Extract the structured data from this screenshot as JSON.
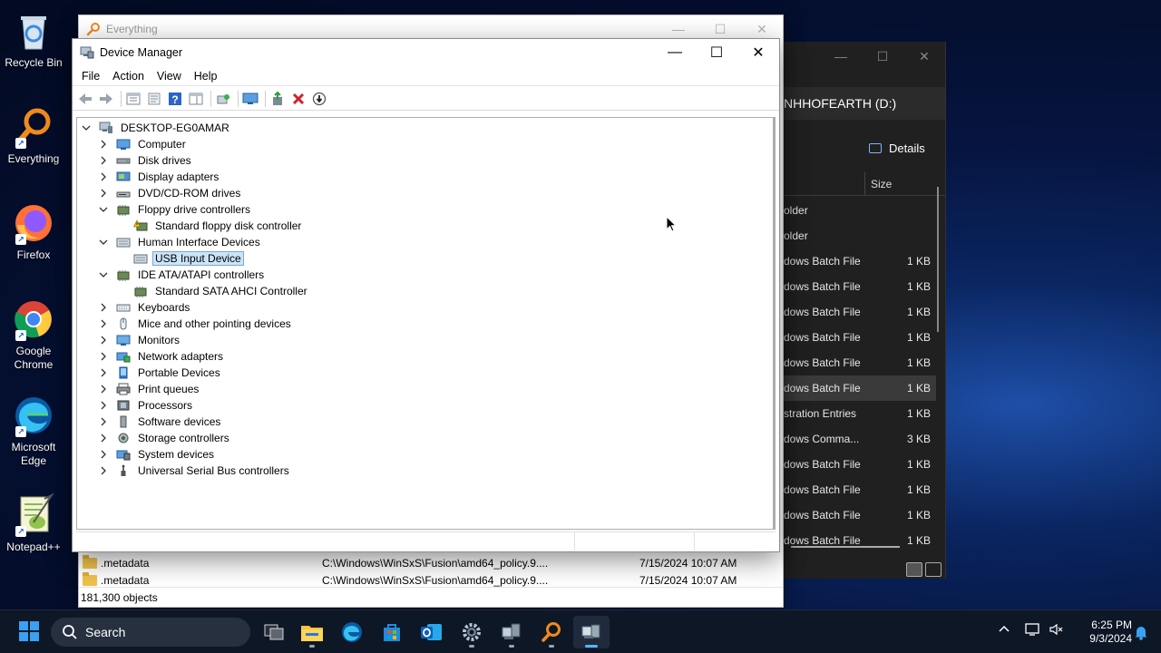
{
  "desktop": {
    "icons": [
      {
        "label": "Recycle Bin",
        "icon": "recycle-bin-icon"
      },
      {
        "label": "Everything",
        "icon": "everything-icon"
      },
      {
        "label": "Firefox",
        "icon": "firefox-icon"
      },
      {
        "label": "Google Chrome",
        "icon": "chrome-icon"
      },
      {
        "label": "Microsoft Edge",
        "icon": "edge-icon"
      },
      {
        "label": "Notepad++",
        "icon": "notepadpp-icon"
      }
    ]
  },
  "everything": {
    "title": "Everything",
    "rows": [
      {
        "name": ".metadata",
        "path": "C:\\Windows\\WinSxS\\Fusion\\amd64_policy.9....",
        "date": "7/15/2024 10:07 AM"
      },
      {
        "name": ".metadata",
        "path": "C:\\Windows\\WinSxS\\Fusion\\amd64_policy.9....",
        "date": "7/15/2024 10:07 AM"
      }
    ],
    "status": "181,300 objects"
  },
  "explorer": {
    "address": "NHHOFEARTH (D:)",
    "details_label": "Details",
    "size_header": "Size",
    "rows": [
      {
        "type": "older",
        "size": ""
      },
      {
        "type": "older",
        "size": ""
      },
      {
        "type": "dows Batch File",
        "size": "1 KB"
      },
      {
        "type": "dows Batch File",
        "size": "1 KB"
      },
      {
        "type": "dows Batch File",
        "size": "1 KB"
      },
      {
        "type": "dows Batch File",
        "size": "1 KB"
      },
      {
        "type": "dows Batch File",
        "size": "1 KB"
      },
      {
        "type": "dows Batch File",
        "size": "1 KB",
        "selected": true
      },
      {
        "type": "stration Entries",
        "size": "1 KB"
      },
      {
        "type": "dows Comma...",
        "size": "3 KB"
      },
      {
        "type": "dows Batch File",
        "size": "1 KB"
      },
      {
        "type": "dows Batch File",
        "size": "1 KB"
      },
      {
        "type": "dows Batch File",
        "size": "1 KB"
      },
      {
        "type": "dows Batch File",
        "size": "1 KB"
      }
    ]
  },
  "device_manager": {
    "title": "Device Manager",
    "menu": [
      "File",
      "Action",
      "View",
      "Help"
    ],
    "root": "DESKTOP-EG0AMAR",
    "tree": [
      {
        "label": "Computer",
        "level": 1,
        "expanded": false,
        "icon": "computer-icon"
      },
      {
        "label": "Disk drives",
        "level": 1,
        "expanded": false,
        "icon": "disk-drive-icon"
      },
      {
        "label": "Display adapters",
        "level": 1,
        "expanded": false,
        "icon": "display-adapter-icon"
      },
      {
        "label": "DVD/CD-ROM drives",
        "level": 1,
        "expanded": false,
        "icon": "dvd-drive-icon"
      },
      {
        "label": "Floppy drive controllers",
        "level": 1,
        "expanded": true,
        "icon": "controller-icon"
      },
      {
        "label": "Standard floppy disk controller",
        "level": 2,
        "icon": "warning-device-icon"
      },
      {
        "label": "Human Interface Devices",
        "level": 1,
        "expanded": true,
        "icon": "hid-icon"
      },
      {
        "label": "USB Input Device",
        "level": 2,
        "icon": "hid-device-icon",
        "selected": true
      },
      {
        "label": "IDE ATA/ATAPI controllers",
        "level": 1,
        "expanded": true,
        "icon": "controller-icon"
      },
      {
        "label": "Standard SATA AHCI Controller",
        "level": 2,
        "icon": "controller-icon"
      },
      {
        "label": "Keyboards",
        "level": 1,
        "expanded": false,
        "icon": "keyboard-icon"
      },
      {
        "label": "Mice and other pointing devices",
        "level": 1,
        "expanded": false,
        "icon": "mouse-icon"
      },
      {
        "label": "Monitors",
        "level": 1,
        "expanded": false,
        "icon": "monitor-icon"
      },
      {
        "label": "Network adapters",
        "level": 1,
        "expanded": false,
        "icon": "network-icon"
      },
      {
        "label": "Portable Devices",
        "level": 1,
        "expanded": false,
        "icon": "portable-device-icon"
      },
      {
        "label": "Print queues",
        "level": 1,
        "expanded": false,
        "icon": "printer-icon"
      },
      {
        "label": "Processors",
        "level": 1,
        "expanded": false,
        "icon": "processor-icon"
      },
      {
        "label": "Software devices",
        "level": 1,
        "expanded": false,
        "icon": "software-device-icon"
      },
      {
        "label": "Storage controllers",
        "level": 1,
        "expanded": false,
        "icon": "storage-icon"
      },
      {
        "label": "System devices",
        "level": 1,
        "expanded": false,
        "icon": "system-device-icon"
      },
      {
        "label": "Universal Serial Bus controllers",
        "level": 1,
        "expanded": false,
        "icon": "usb-icon"
      }
    ]
  },
  "taskbar": {
    "search_label": "Search",
    "time": "6:25 PM",
    "date": "9/3/2024"
  }
}
